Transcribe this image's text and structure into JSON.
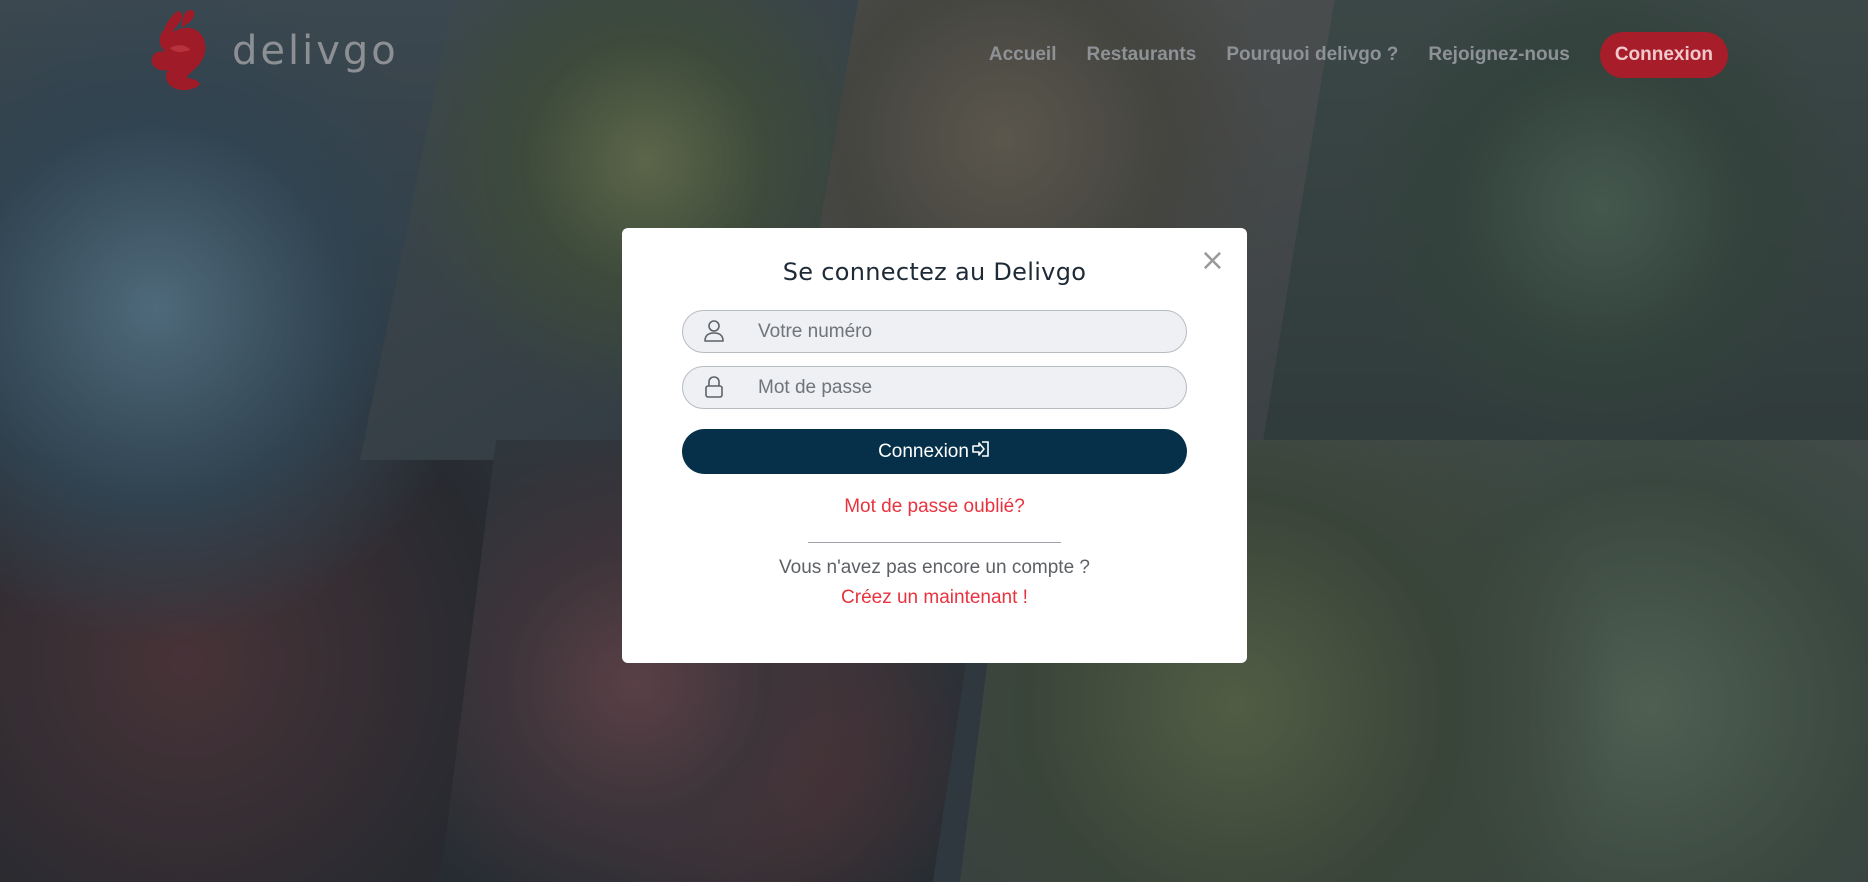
{
  "colors": {
    "brand_red": "#a71d2a",
    "button_navy": "#06304a",
    "link_red": "#e8333f"
  },
  "brand": {
    "name": "delivgo",
    "logo_icon": "rabbit-logo-icon"
  },
  "nav": {
    "items": [
      {
        "label": "Accueil"
      },
      {
        "label": "Restaurants"
      },
      {
        "label": "Pourquoi delivgo ?"
      },
      {
        "label": "Rejoignez-nous"
      }
    ],
    "login_button": "Connexion"
  },
  "modal": {
    "title": "Se connectez au Delivgo",
    "close_icon": "close-icon",
    "phone_placeholder": "Votre numéro",
    "phone_value": "",
    "password_placeholder": "Mot de passe",
    "password_value": "",
    "submit_label": "Connexion",
    "submit_icon": "sign-in-icon",
    "forgot_password": "Mot de passe oublié?",
    "no_account_text": "Vous n'avez pas encore un compte ?",
    "create_account_link": "Créez un maintenant !"
  }
}
